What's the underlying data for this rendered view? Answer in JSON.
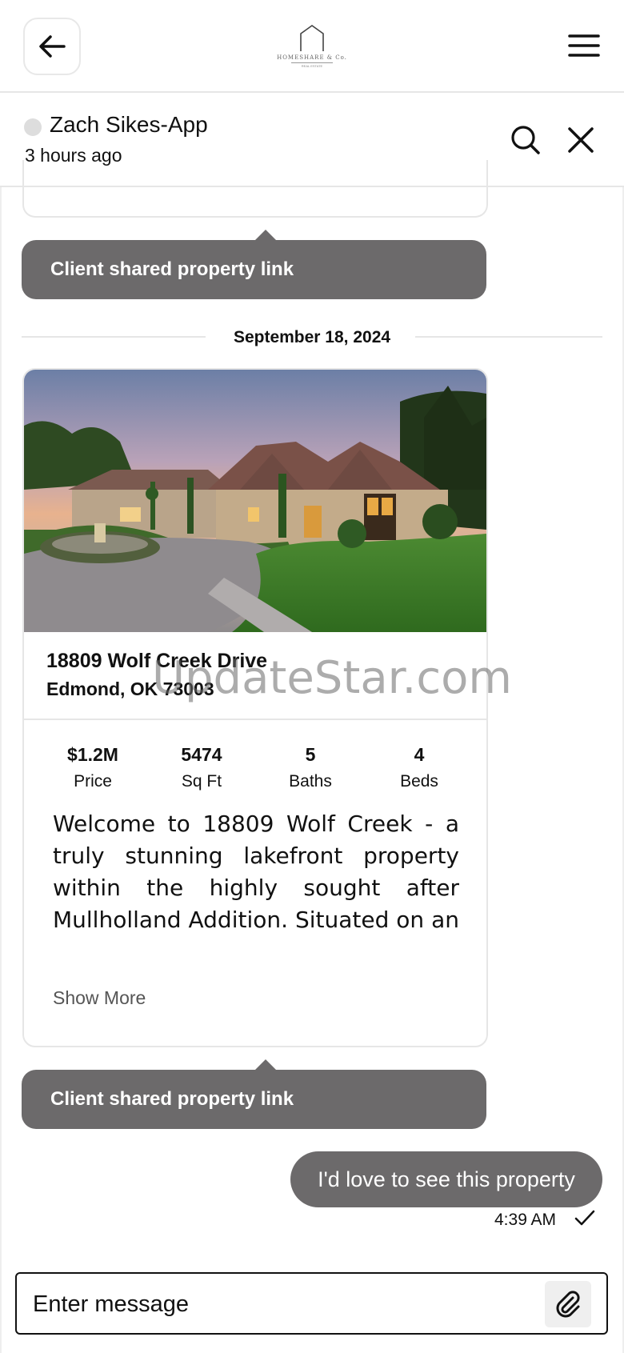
{
  "header": {
    "logo_text": "HOMESHARE & Co.",
    "logo_sub": "REAL ESTATE"
  },
  "chat": {
    "contact_name": "Zach Sikes-App",
    "last_seen": "3 hours ago"
  },
  "shared_label": "Client shared property link",
  "date_separator": "September 18, 2024",
  "property": {
    "address_line1": "18809 Wolf Creek Drive",
    "address_line2": "Edmond, OK 73003",
    "stats": [
      {
        "value": "$1.2M",
        "label": "Price"
      },
      {
        "value": "5474",
        "label": "Sq Ft"
      },
      {
        "value": "5",
        "label": "Baths"
      },
      {
        "value": "4",
        "label": "Beds"
      }
    ],
    "description": "Welcome to 18809 Wolf Creek - a truly stunning lakefront property within the highly sought after Mullholland Addition. Situated on an expansive lot with picturesque views of the lake",
    "show_more": "Show More"
  },
  "watermark": "UpdateStar.com",
  "message": {
    "text": "I'd love to see this property",
    "time": "4:39 AM"
  },
  "composer": {
    "placeholder": "Enter message"
  },
  "colors": {
    "bubble": "#6c6a6b",
    "border": "#e6e6e6"
  }
}
